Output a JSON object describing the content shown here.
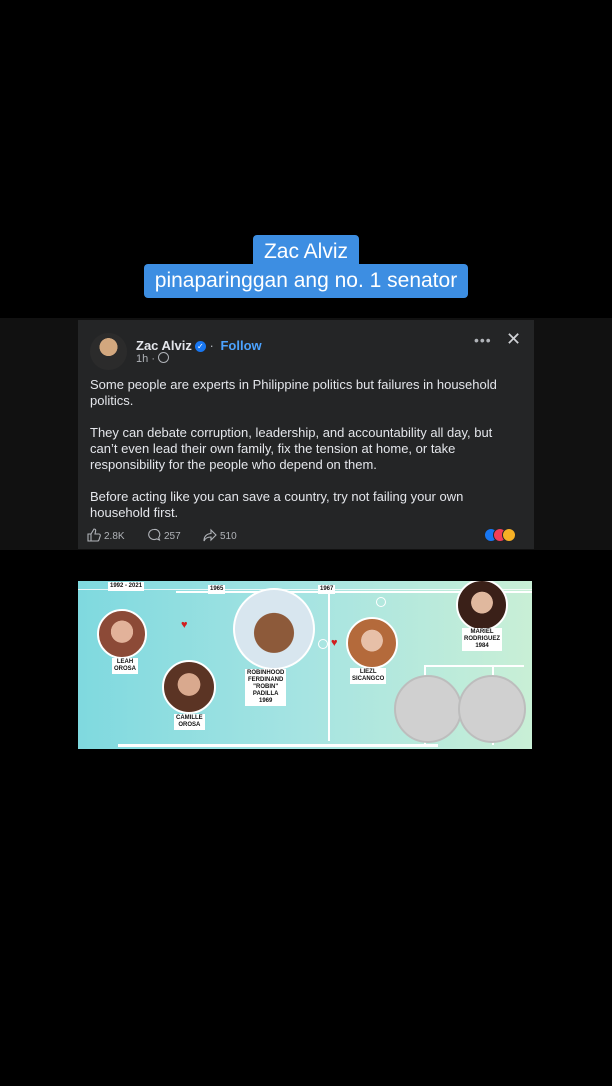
{
  "caption": {
    "line1": "Zac Alviz",
    "line2": "pinaparinggan ang no. 1 senator"
  },
  "post": {
    "author": "Zac Alviz",
    "follow_label": "Follow",
    "time": "1h",
    "separator": "·",
    "paragraphs": [
      "Some people are experts in Philippine politics but failures in household politics.",
      "They can debate corruption, leadership, and accountability all day, but can’t even lead their own family, fix the tension at home, or take responsibility for the people who depend on them.",
      "Before acting like you can save a country, try not failing your own household first."
    ],
    "likes": "2.8K",
    "comments": "257",
    "shares": "510",
    "icons": [
      "verified-badge-icon",
      "globe-icon",
      "more-icon",
      "close-icon",
      "like-icon",
      "comment-icon",
      "share-icon",
      "reactions-icon"
    ]
  },
  "tree": {
    "top_years": [
      "1992 - 2021",
      "1965",
      "1967"
    ],
    "leah": [
      "LEAH",
      "OROSA"
    ],
    "camille": [
      "CAMILLE",
      "OROSA"
    ],
    "robin": [
      "ROBINHOOD",
      "FERDINAND",
      "\"ROBIN\"",
      "PADILLA",
      "1969"
    ],
    "liezl": [
      "LIEZL",
      "SICANGCO"
    ],
    "mariel": [
      "MARIEL",
      "RODRIGUEZ",
      "1984"
    ]
  },
  "colors": {
    "caption_bg": "#3d8ee2",
    "post_bg": "#242526",
    "link": "#4ca3ff",
    "tree_bg_start": "#7fd9df",
    "tree_bg_end": "#c9efd6"
  }
}
